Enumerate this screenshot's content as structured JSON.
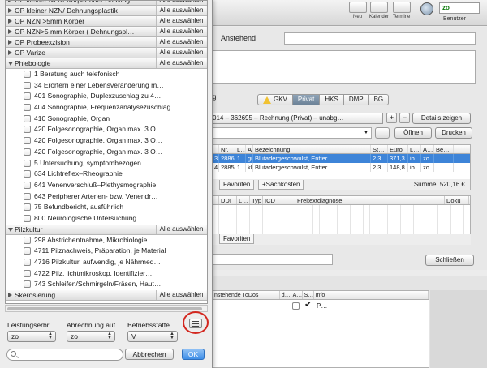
{
  "toolbar": {
    "buttons": [
      {
        "label": "Neu"
      },
      {
        "label": "Kalender"
      },
      {
        "label": "Termine"
      }
    ],
    "user_value": "zo",
    "user_label": "Benutzer"
  },
  "form": {
    "anstehend_label": "Anstehend"
  },
  "invoice_tabs": [
    "GKV",
    "Privat",
    "HKS",
    "DMP",
    "BG"
  ],
  "active_tab": "Privat",
  "invoice_select": "014 – 362695 – Rechnung (Privat) – unabg…",
  "buttons": {
    "plus": "+",
    "minus": "−",
    "details": "Details zeigen",
    "oeffnen": "Öffnen",
    "drucken": "Drucken",
    "schliessen": "Schließen"
  },
  "partial_label_g": "g",
  "service_table": {
    "headers": [
      "",
      "Nr.",
      "L…",
      "A…",
      "Bezeichnung",
      "St…",
      "Euro",
      "L…",
      "A…",
      "Be…"
    ],
    "rows": [
      {
        "c1": "3",
        "nr": "2886",
        "l": "1",
        "a": "gr.",
        "bez": "Blutadergeschwulst, Entfer…",
        "st": "2,3",
        "euro": "371,3…",
        "l2": "ib",
        "a2": "zo",
        "be": ""
      },
      {
        "c1": "4",
        "nr": "2885",
        "l": "1",
        "a": "kl.",
        "bez": "Blutadergeschwulst, Entfer…",
        "st": "2,3",
        "euro": "148,8…",
        "l2": "ib",
        "a2": "zo",
        "be": ""
      }
    ],
    "tab_favoriten": "Favoriten",
    "tab_sachkosten": "+Sachkosten",
    "summe": "Summe: 520,16 €"
  },
  "diagnosis_table": {
    "headers": [
      "",
      "DDI",
      "L…",
      "Typ",
      "ICD",
      "Freitextdiagnose",
      "Doku"
    ],
    "tab_favoriten": "Favoriten"
  },
  "todo_table": {
    "headers": [
      "nstehende ToDos",
      "d…",
      "A…",
      "S…",
      "Info"
    ],
    "row_status": "P…"
  },
  "popover": {
    "groups": [
      {
        "label": "OP kleiner NZN/ Körper oder Shaving…",
        "open": false,
        "button": "Alle auswählen"
      },
      {
        "label": "OP kleiner NZN/ Dehnungsplastik",
        "open": false,
        "button": "Alle auswählen"
      },
      {
        "label": "OP NZN >5mm Körper",
        "open": false,
        "button": "Alle auswählen"
      },
      {
        "label": "OP NZN>5 mm Körper ( Dehnungspl…",
        "open": false,
        "button": "Alle auswählen"
      },
      {
        "label": "OP Probeexzision",
        "open": false,
        "button": "Alle auswählen"
      },
      {
        "label": "OP Varize",
        "open": false,
        "button": "Alle auswählen"
      },
      {
        "label": "Phlebologie",
        "open": true,
        "button": "Alle auswählen",
        "items": [
          "1 Beratung auch telefonisch",
          "34 Erörtern einer Lebensveränderung m…",
          "401 Sonographie, Duplexzuschlag zu 4…",
          "404 Sonographie, Frequenzanalysezuschlag",
          "410 Sonographie, Organ",
          "420 Folgesonographie, Organ max. 3 O…",
          "420 Folgesonographie, Organ max. 3 O…",
          "420 Folgesonographie, Organ max. 3 O…",
          "5 Untersuchung, symptombezogen",
          "634 Lichtreflex–Rheographie",
          "641 Venenverschluß–Plethysmographie",
          "643 Peripherer Arterien- bzw. Venendr…",
          "75 Befundbericht, ausführlich",
          "800 Neurologische Untersuchung"
        ]
      },
      {
        "label": "Pilzkultur",
        "open": true,
        "button": "Alle auswählen",
        "items": [
          "298 Abstrichentnahme, Mikrobiologie",
          "4711 Pilznachweis, Präparation, je Material",
          "4716 Pilzkultur, aufwendig, je Nährmed…",
          "4722 Pilz, lichtmikroskop. Identifizier…",
          "743 Schleifen/Schmirgeln/Fräsen, Haut…"
        ]
      },
      {
        "label": "Skerosierung",
        "open": false,
        "button": "Alle auswählen"
      }
    ],
    "leistungserbr_label": "Leistungserbr.",
    "leistungserbr_value": "zo",
    "abrechnung_label": "Abrechnung auf",
    "abrechnung_value": "zo",
    "betriebsstaette_label": "Betriebsstätte",
    "betriebsstaette_value": "V",
    "search_placeholder": "",
    "abbrechen": "Abbrechen",
    "ok": "OK"
  },
  "colors": {
    "selection": "#3d84d8",
    "highlight_ring": "#d3271f",
    "ok_button": "#3f8fe8",
    "user_text": "#0b7a0b"
  }
}
